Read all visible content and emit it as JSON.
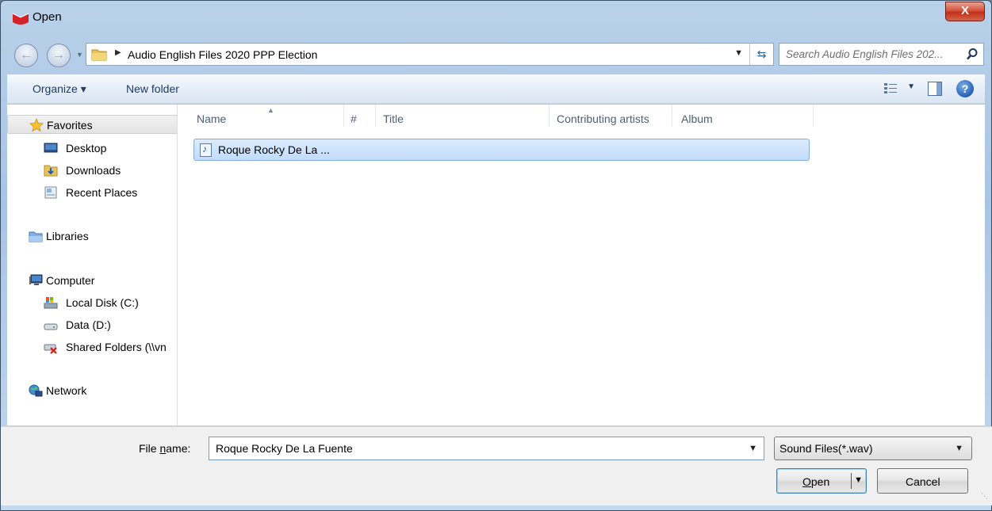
{
  "window": {
    "title": "Open",
    "close_glyph": "X"
  },
  "navigation": {
    "back_icon": "back-arrow-icon",
    "forward_icon": "forward-arrow-icon",
    "breadcrumb": "Audio English Files 2020 PPP Election",
    "search_placeholder": "Search Audio English Files 202..."
  },
  "toolbar": {
    "organize_label": "Organize ▾",
    "new_folder_label": "New folder"
  },
  "sidebar": {
    "favorites": "Favorites",
    "desktop": "Desktop",
    "downloads": "Downloads",
    "recent_places": "Recent Places",
    "libraries": "Libraries",
    "computer": "Computer",
    "local_disk": "Local Disk (C:)",
    "data_drive": "Data (D:)",
    "shared_folders": "Shared Folders (\\\\vn",
    "network": "Network"
  },
  "file_list": {
    "columns": [
      "Name",
      "#",
      "Title",
      "Contributing artists",
      "Album"
    ],
    "files": [
      {
        "name": "Roque Rocky De La ..."
      }
    ]
  },
  "footer": {
    "file_name_label_pre": "File ",
    "file_name_label_accel": "n",
    "file_name_label_post": "ame:",
    "file_name_value": "Roque Rocky De La Fuente",
    "file_type_value": "Sound Files(*.wav)",
    "open_accel": "O",
    "open_rest": "pen",
    "cancel_label": "Cancel"
  }
}
